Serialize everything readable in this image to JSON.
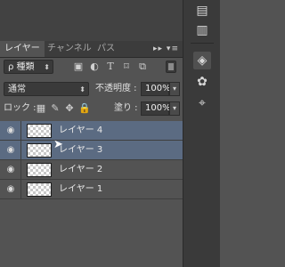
{
  "tabs": [
    {
      "label": "レイヤー",
      "active": true
    },
    {
      "label": "チャンネル",
      "active": false
    },
    {
      "label": "パス",
      "active": false
    }
  ],
  "tab_menu_glyph": "▸▸ ▾≡",
  "filter": {
    "kind_label": "ρ 種類",
    "icons": [
      "image-filter-icon",
      "adjustment-filter-icon",
      "type-filter-icon",
      "shape-filter-icon",
      "smart-object-filter-icon"
    ]
  },
  "blend": {
    "mode": "通常",
    "opacity_label": "不透明度 :",
    "opacity_value": "100%"
  },
  "lock": {
    "label": "ロック :",
    "fill_label": "塗り :",
    "fill_value": "100%"
  },
  "layers": [
    {
      "name": "レイヤー 4",
      "selected": true
    },
    {
      "name": "レイヤー 3",
      "selected": true
    },
    {
      "name": "レイヤー 2",
      "selected": false
    },
    {
      "name": "レイヤー 1",
      "selected": false
    }
  ],
  "icons": {
    "eye": "◉",
    "arrow_down": "▾",
    "arrow_updown": "⬍",
    "cursor": "➤"
  }
}
